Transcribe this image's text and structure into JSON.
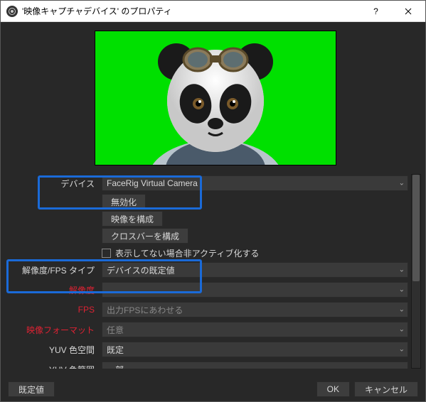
{
  "title": "'映像キャプチャデバイス' のプロパティ",
  "labels": {
    "device": "デバイス",
    "resfps": "解像度/FPS タイプ",
    "resolution": "解像度",
    "fps": "FPS",
    "videofmt": "映像フォーマット",
    "yuvspace": "YUV 色空間",
    "yuvrange": "YUV 色範囲"
  },
  "values": {
    "device": "FaceRig Virtual Camera",
    "resfps": "デバイスの既定値",
    "resolution": "",
    "fps": "出力FPSにあわせる",
    "videofmt": "任意",
    "yuvspace": "既定",
    "yuvrange": "一部"
  },
  "buttons": {
    "disable": "無効化",
    "configVideo": "映像を構成",
    "configCrossbar": "クロスバーを構成"
  },
  "checkbox": {
    "deactivate": "表示してない場合非アクティブ化する"
  },
  "footer": {
    "defaults": "既定値",
    "ok": "OK",
    "cancel": "キャンセル"
  }
}
